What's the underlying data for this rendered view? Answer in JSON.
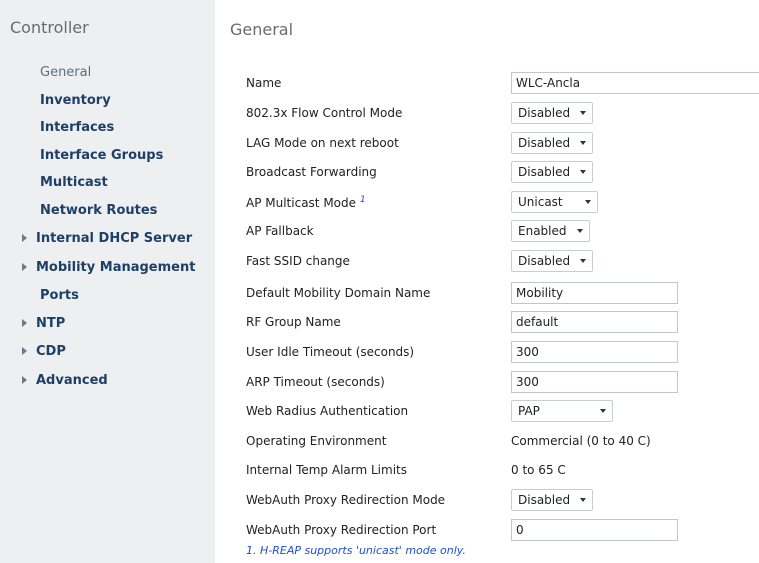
{
  "sidebar": {
    "title": "Controller",
    "items": [
      {
        "label": "General"
      },
      {
        "label": "Inventory"
      },
      {
        "label": "Interfaces"
      },
      {
        "label": "Interface Groups"
      },
      {
        "label": "Multicast"
      },
      {
        "label": "Network Routes"
      },
      {
        "label": "Internal DHCP Server"
      },
      {
        "label": "Mobility Management"
      },
      {
        "label": "Ports"
      },
      {
        "label": "NTP"
      },
      {
        "label": "CDP"
      },
      {
        "label": "Advanced"
      }
    ]
  },
  "main": {
    "title": "General",
    "fields": [
      {
        "label": "Name",
        "value": "WLC-Ancla"
      },
      {
        "label": "802.3x Flow Control Mode",
        "value": "Disabled"
      },
      {
        "label": "LAG Mode on next reboot",
        "value": "Disabled"
      },
      {
        "label": "Broadcast Forwarding",
        "value": "Disabled"
      },
      {
        "label": "AP Multicast Mode",
        "footnote_mark": "1",
        "value": "Unicast"
      },
      {
        "label": "AP Fallback",
        "value": "Enabled"
      },
      {
        "label": "Fast SSID change",
        "value": "Disabled"
      },
      {
        "label": "Default Mobility Domain Name",
        "value": "Mobility"
      },
      {
        "label": "RF Group Name",
        "value": "default"
      },
      {
        "label": "User Idle Timeout (seconds)",
        "value": "300"
      },
      {
        "label": "ARP Timeout (seconds)",
        "value": "300"
      },
      {
        "label": "Web Radius Authentication",
        "value": "PAP"
      },
      {
        "label": "Operating Environment",
        "value": "Commercial (0 to 40 C)"
      },
      {
        "label": "Internal Temp Alarm Limits",
        "value": "0 to 65 C"
      },
      {
        "label": "WebAuth Proxy Redirection Mode",
        "value": "Disabled"
      },
      {
        "label": "WebAuth Proxy Redirection Port",
        "value": "0"
      }
    ],
    "footnote": "1. H-REAP supports 'unicast' mode only."
  }
}
